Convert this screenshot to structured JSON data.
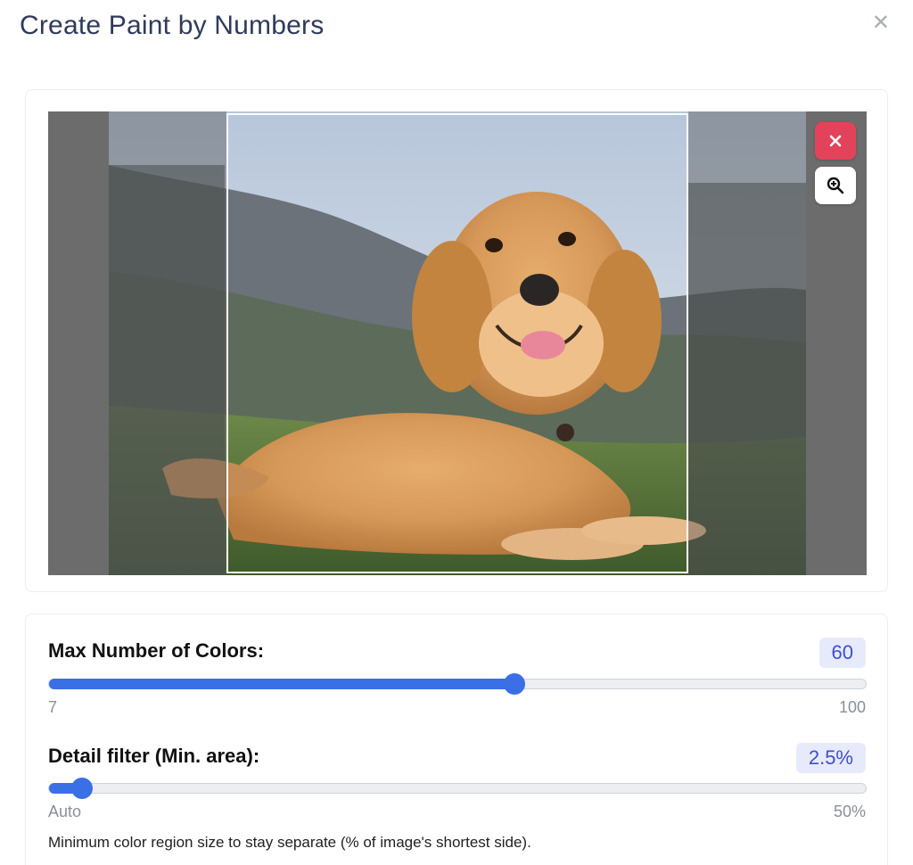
{
  "dialog": {
    "title": "Create Paint by Numbers",
    "close_icon": "close-icon"
  },
  "preview": {
    "image_description_icons": [
      "remove-icon",
      "zoom-in-icon"
    ],
    "colors": {
      "remove_button": "#e3435a"
    }
  },
  "settings": {
    "max_colors": {
      "label": "Max Number of Colors:",
      "value": "60",
      "min_label": "7",
      "max_label": "100",
      "level": 0.57
    },
    "detail_filter": {
      "label": "Detail filter (Min. area):",
      "value": "2.5%",
      "min_label": "Auto",
      "max_label": "50%",
      "level": 0.04,
      "hint": "Minimum color region size to stay separate (% of image's shortest side)."
    },
    "colors": {
      "accent": "#3a6fe6",
      "badge_bg": "#e7eafb",
      "badge_text": "#3e4fd1"
    }
  }
}
